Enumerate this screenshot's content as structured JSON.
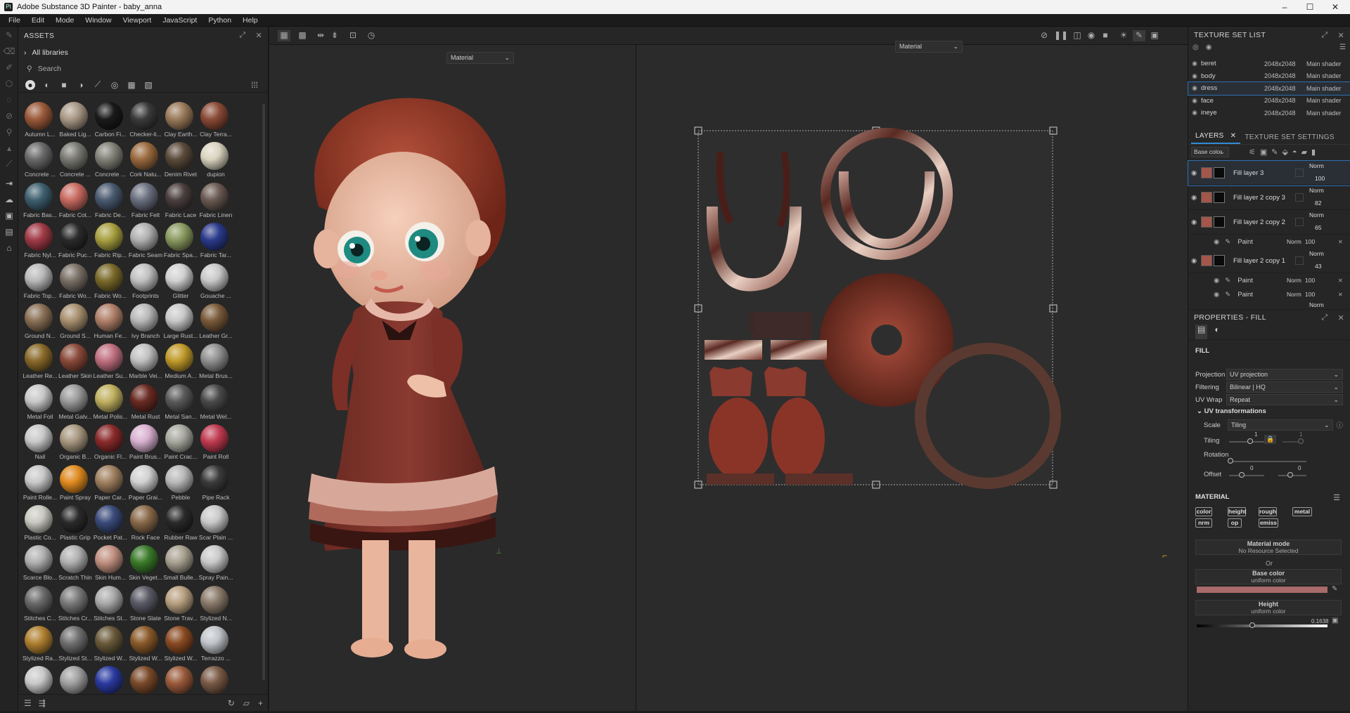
{
  "title": "Adobe Substance 3D Painter - baby_anna",
  "app_icon": "Pt",
  "menu": [
    "File",
    "Edit",
    "Mode",
    "Window",
    "Viewport",
    "JavaScript",
    "Python",
    "Help"
  ],
  "assets": {
    "header": "ASSETS",
    "library": "All libraries",
    "search_placeholder": "Search",
    "materials": [
      {
        "label": "Autumn L...",
        "color": "#9a5a3a"
      },
      {
        "label": "Baked Lig...",
        "color": "#a99886"
      },
      {
        "label": "Carbon Fi...",
        "color": "#1a1a1a"
      },
      {
        "label": "Checker-li...",
        "color": "#3a3a3a"
      },
      {
        "label": "Clay Earth...",
        "color": "#9a7a5a"
      },
      {
        "label": "Clay Terra...",
        "color": "#8a4a36"
      },
      {
        "label": "Concrete ...",
        "color": "#6a6a6a"
      },
      {
        "label": "Concrete ...",
        "color": "#7a7a72"
      },
      {
        "label": "Concrete ...",
        "color": "#828278"
      },
      {
        "label": "Cork Natu...",
        "color": "#9a6a3e"
      },
      {
        "label": "Denim Rivet",
        "color": "#5a4a3a"
      },
      {
        "label": "dupion",
        "color": "#d9d3bf"
      },
      {
        "label": "Fabric Bas...",
        "color": "#3e6070"
      },
      {
        "label": "Fabric Cot...",
        "color": "#c86a60"
      },
      {
        "label": "Fabric De...",
        "color": "#4a5a70"
      },
      {
        "label": "Fabric Felt",
        "color": "#6a7080"
      },
      {
        "label": "Fabric Lace",
        "color": "#4a3e3e"
      },
      {
        "label": "Fabric Linen",
        "color": "#6a5a52"
      },
      {
        "label": "Fabric Nyl...",
        "color": "#a03a46"
      },
      {
        "label": "Fabric Puc...",
        "color": "#2a2a2a"
      },
      {
        "label": "Fabric Rip...",
        "color": "#a8a040"
      },
      {
        "label": "Fabric Seam",
        "color": "#b0b0b0"
      },
      {
        "label": "Fabric Spa...",
        "color": "#8a9a60"
      },
      {
        "label": "Fabric Tar...",
        "color": "#2a3a8a"
      },
      {
        "label": "Fabric Top...",
        "color": "#b8b8b8"
      },
      {
        "label": "Fabric Wo...",
        "color": "#7a7066"
      },
      {
        "label": "Fabric Wo...",
        "color": "#7a6a2a"
      },
      {
        "label": "Footprints",
        "color": "#c0c0c0"
      },
      {
        "label": "Glitter",
        "color": "#d0d0d0"
      },
      {
        "label": "Gouache ...",
        "color": "#c8c8c8"
      },
      {
        "label": "Ground N...",
        "color": "#8a7056"
      },
      {
        "label": "Ground S...",
        "color": "#a89070"
      },
      {
        "label": "Human Fe...",
        "color": "#b0806a"
      },
      {
        "label": "Ivy Branch",
        "color": "#b8b8b8"
      },
      {
        "label": "Large Rust...",
        "color": "#c8c8c8"
      },
      {
        "label": "Leather Gr...",
        "color": "#7a5a3a"
      },
      {
        "label": "Leather Re...",
        "color": "#8a6a2a"
      },
      {
        "label": "Leather Skin",
        "color": "#8a4a3a"
      },
      {
        "label": "Leather Su...",
        "color": "#c07080"
      },
      {
        "label": "Marble Vei...",
        "color": "#c0c0c0"
      },
      {
        "label": "Medium A...",
        "color": "#c09a2a"
      },
      {
        "label": "Metal Brus...",
        "color": "#909090"
      },
      {
        "label": "Metal Foil",
        "color": "#c8c8c8"
      },
      {
        "label": "Metal Galv...",
        "color": "#9a9a9a"
      },
      {
        "label": "Metal Polis...",
        "color": "#c0b060"
      },
      {
        "label": "Metal Rust",
        "color": "#6a2a22"
      },
      {
        "label": "Metal San...",
        "color": "#5a5a5a"
      },
      {
        "label": "Metal Wel...",
        "color": "#4a4a4a"
      },
      {
        "label": "Nail",
        "color": "#c8c8c8"
      },
      {
        "label": "Organic B...",
        "color": "#a89880"
      },
      {
        "label": "Organic Fl...",
        "color": "#8a2a2a"
      },
      {
        "label": "Paint Brus...",
        "color": "#d8b0d0"
      },
      {
        "label": "Paint Crac...",
        "color": "#a8a8a0"
      },
      {
        "label": "Paint Roll",
        "color": "#c03a50"
      },
      {
        "label": "Paint Rolle...",
        "color": "#c8c8c8"
      },
      {
        "label": "Paint Spray",
        "color": "#e08a20"
      },
      {
        "label": "Paper Car...",
        "color": "#a08060"
      },
      {
        "label": "Paper Grai...",
        "color": "#d0d0d0"
      },
      {
        "label": "Pebble",
        "color": "#b8b8b8"
      },
      {
        "label": "Pipe Rack",
        "color": "#3a3a3a"
      },
      {
        "label": "Plastic Co...",
        "color": "#c8c8c0"
      },
      {
        "label": "Plastic Grip",
        "color": "#2a2a2a"
      },
      {
        "label": "Pocket Pat...",
        "color": "#3a4a7a"
      },
      {
        "label": "Rock Face",
        "color": "#8a6a4a"
      },
      {
        "label": "Rubber Raw",
        "color": "#2a2a2a"
      },
      {
        "label": "Scar Plain ...",
        "color": "#c8c8c8"
      },
      {
        "label": "Scarce Blo...",
        "color": "#b0b0b0"
      },
      {
        "label": "Scratch Thin",
        "color": "#b0b0b0"
      },
      {
        "label": "Skin Hum...",
        "color": "#c09080"
      },
      {
        "label": "Skin Veget...",
        "color": "#3a7a2a"
      },
      {
        "label": "Small Bulle...",
        "color": "#a8a090"
      },
      {
        "label": "Spray Pain...",
        "color": "#c8c8c8"
      },
      {
        "label": "Stitches C...",
        "color": "#6a6a6a"
      },
      {
        "label": "Stitches Cr...",
        "color": "#7a7a7a"
      },
      {
        "label": "Stitches St...",
        "color": "#aaaaaa"
      },
      {
        "label": "Stone Slate",
        "color": "#5a5a66"
      },
      {
        "label": "Stone Trav...",
        "color": "#b8a080"
      },
      {
        "label": "Stylized N...",
        "color": "#8a7a6a"
      },
      {
        "label": "Stylized Ra...",
        "color": "#b08030"
      },
      {
        "label": "Stylized St...",
        "color": "#707070"
      },
      {
        "label": "Stylized W...",
        "color": "#6a5a3a"
      },
      {
        "label": "Stylized W...",
        "color": "#8a5a2a"
      },
      {
        "label": "Stylized W...",
        "color": "#8a4a22"
      },
      {
        "label": "Terrazzo ...",
        "color": "#c0c4c8"
      },
      {
        "label": "",
        "color": "#c8c8c8"
      },
      {
        "label": "",
        "color": "#a0a0a0"
      },
      {
        "label": "",
        "color": "#2a3aa0"
      },
      {
        "label": "",
        "color": "#7a4a2a"
      },
      {
        "label": "",
        "color": "#9a5a3a"
      },
      {
        "label": "",
        "color": "#7a5a46"
      }
    ]
  },
  "viewport": {
    "dropdown_3d": "Material",
    "dropdown_2d": "Material"
  },
  "texture_set_list": {
    "header": "TEXTURE SET LIST",
    "rows": [
      {
        "name": "beret",
        "res": "2048x2048",
        "shader": "Main shader"
      },
      {
        "name": "body",
        "res": "2048x2048",
        "shader": "Main shader"
      },
      {
        "name": "dress",
        "res": "2048x2048",
        "shader": "Main shader"
      },
      {
        "name": "face",
        "res": "2048x2048",
        "shader": "Main shader"
      },
      {
        "name": "ineye",
        "res": "2048x2048",
        "shader": "Main shader"
      }
    ]
  },
  "layers": {
    "tab_layers": "LAYERS",
    "tab_settings": "TEXTURE SET SETTINGS",
    "channel": "Base color",
    "items": [
      {
        "name": "Fill layer 3",
        "blend": "Norm",
        "opacity": "100"
      },
      {
        "name": "Fill layer 2 copy 3",
        "blend": "Norm",
        "opacity": "82"
      },
      {
        "name": "Fill layer 2 copy 2",
        "blend": "Norm",
        "opacity": "65"
      },
      {
        "name": "Fill layer 2 copy 1",
        "blend": "Norm",
        "opacity": "43"
      }
    ],
    "sub_paint": {
      "name": "Paint",
      "blend": "Norm",
      "opacity": "100"
    },
    "last_blend": "Norm"
  },
  "properties": {
    "header": "PROPERTIES - FILL",
    "fill": "FILL",
    "projection_label": "Projection",
    "projection": "UV projection",
    "filtering_label": "Filtering",
    "filtering": "Bilinear | HQ",
    "uvwrap_label": "UV Wrap",
    "uvwrap": "Repeat",
    "uvt": "UV transformations",
    "scale_label": "Scale",
    "scale": "Tiling",
    "tiling_label": "Tiling",
    "tiling_a": "1",
    "tiling_b": "1",
    "rotation_label": "Rotation",
    "offset_label": "Offset",
    "offset_a": "0",
    "offset_b": "0",
    "material": "MATERIAL",
    "chips": [
      "color",
      "height",
      "rough",
      "metal",
      "nrm",
      "op",
      "emiss"
    ],
    "material_mode": "Material mode",
    "no_resource": "No Resource Selected",
    "or": "Or",
    "base_color": "Base color",
    "uniform": "uniform color",
    "base_color_value": "#a86a6a",
    "height": "Height",
    "height_value": "0.1638"
  }
}
